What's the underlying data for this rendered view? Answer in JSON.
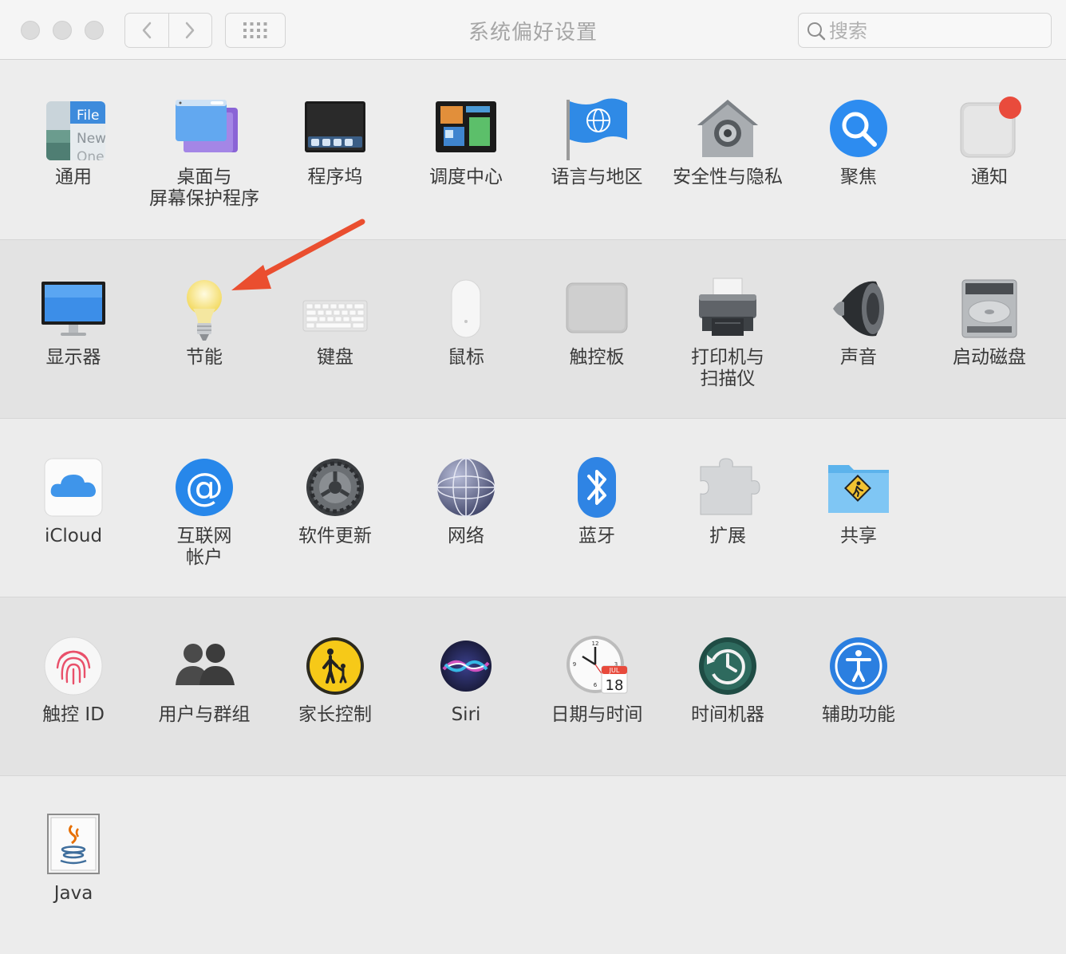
{
  "window": {
    "title": "系统偏好设置",
    "search": {
      "placeholder": "搜索",
      "value": ""
    }
  },
  "sections": [
    {
      "panes": [
        {
          "id": "general",
          "icon": "general-icon",
          "label": "通用",
          "icon_text": [
            "File",
            "New",
            "One"
          ]
        },
        {
          "id": "desktop-screensaver",
          "icon": "desktop-screensaver-icon",
          "label": "桌面与\n屏幕保护程序"
        },
        {
          "id": "dock",
          "icon": "dock-icon",
          "label": "程序坞"
        },
        {
          "id": "mission-control",
          "icon": "mission-control-icon",
          "label": "调度中心"
        },
        {
          "id": "language-region",
          "icon": "globe-flag-icon",
          "label": "语言与地区"
        },
        {
          "id": "security-privacy",
          "icon": "security-house-icon",
          "label": "安全性与隐私"
        },
        {
          "id": "spotlight",
          "icon": "magnifier-icon",
          "label": "聚焦"
        },
        {
          "id": "notifications",
          "icon": "notifications-icon",
          "label": "通知"
        }
      ]
    },
    {
      "panes": [
        {
          "id": "displays",
          "icon": "monitor-icon",
          "label": "显示器"
        },
        {
          "id": "energy-saver",
          "icon": "lightbulb-icon",
          "label": "节能"
        },
        {
          "id": "keyboard",
          "icon": "keyboard-icon",
          "label": "键盘"
        },
        {
          "id": "mouse",
          "icon": "mouse-icon",
          "label": "鼠标"
        },
        {
          "id": "trackpad",
          "icon": "trackpad-icon",
          "label": "触控板"
        },
        {
          "id": "printers-scanners",
          "icon": "printer-icon",
          "label": "打印机与\n扫描仪"
        },
        {
          "id": "sound",
          "icon": "speaker-icon",
          "label": "声音"
        },
        {
          "id": "startup-disk",
          "icon": "hard-disk-icon",
          "label": "启动磁盘"
        }
      ]
    },
    {
      "panes": [
        {
          "id": "icloud",
          "icon": "icloud-icon",
          "label": "iCloud"
        },
        {
          "id": "internet-accounts",
          "icon": "at-sign-icon",
          "label": "互联网\n帐户"
        },
        {
          "id": "software-update",
          "icon": "gear-icon",
          "label": "软件更新"
        },
        {
          "id": "network",
          "icon": "network-globe-icon",
          "label": "网络"
        },
        {
          "id": "bluetooth",
          "icon": "bluetooth-icon",
          "label": "蓝牙"
        },
        {
          "id": "extensions",
          "icon": "puzzle-piece-icon",
          "label": "扩展"
        },
        {
          "id": "sharing",
          "icon": "sharing-folder-icon",
          "label": "共享"
        }
      ]
    },
    {
      "panes": [
        {
          "id": "touch-id",
          "icon": "fingerprint-icon",
          "label": "触控 ID"
        },
        {
          "id": "users-groups",
          "icon": "users-icon",
          "label": "用户与群组"
        },
        {
          "id": "parental-controls",
          "icon": "parental-controls-icon",
          "label": "家长控制"
        },
        {
          "id": "siri",
          "icon": "siri-icon",
          "label": "Siri"
        },
        {
          "id": "date-time",
          "icon": "clock-calendar-icon",
          "label": "日期与时间",
          "icon_text": [
            "JUL",
            "18"
          ]
        },
        {
          "id": "time-machine",
          "icon": "time-machine-icon",
          "label": "时间机器"
        },
        {
          "id": "accessibility",
          "icon": "accessibility-icon",
          "label": "辅助功能"
        }
      ]
    },
    {
      "panes": [
        {
          "id": "java",
          "icon": "java-icon",
          "label": "Java"
        }
      ]
    }
  ],
  "annotation": {
    "icon": "red-arrow-icon",
    "color": "#ea4e2f",
    "points_to": "energy-saver"
  }
}
